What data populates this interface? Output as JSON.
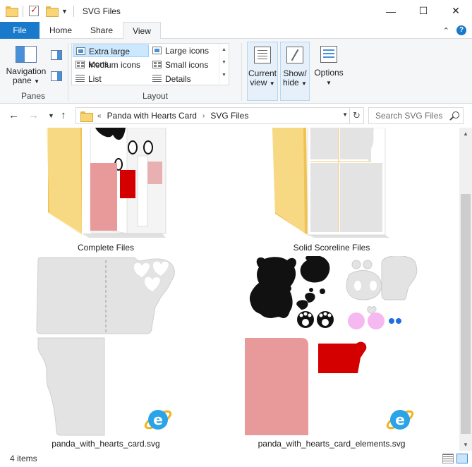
{
  "window": {
    "title": "SVG Files",
    "minimize": "—",
    "maximize": "☐",
    "close": "✕"
  },
  "ribbon": {
    "tabs": {
      "file": "File",
      "home": "Home",
      "share": "Share",
      "view": "View"
    },
    "collapse_glyph": "⌃",
    "help_glyph": "?",
    "panes": {
      "group_label": "Panes",
      "navigation_pane_line1": "Navigation",
      "navigation_pane_line2": "pane"
    },
    "layout": {
      "group_label": "Layout",
      "items": {
        "extra_large": "Extra large icons",
        "large": "Large icons",
        "medium": "Medium icons",
        "small": "Small icons",
        "list": "List",
        "details": "Details"
      },
      "selected": "Extra large icons"
    },
    "current_view": {
      "line1": "Current",
      "line2": "view"
    },
    "show_hide": {
      "line1": "Show/",
      "line2": "hide"
    },
    "options": {
      "label": "Options"
    }
  },
  "address": {
    "crumbs": [
      "Panda with Hearts Card",
      "SVG Files"
    ],
    "search_placeholder": "Search SVG Files"
  },
  "files": [
    {
      "name": "Complete Files",
      "type": "folder"
    },
    {
      "name": "Solid Scoreline Files",
      "type": "folder"
    },
    {
      "name": "panda_with_hearts_card.svg",
      "type": "svg"
    },
    {
      "name": "panda_with_hearts_card_elements.svg",
      "type": "svg"
    }
  ],
  "status": {
    "item_count": "4 items"
  },
  "colors": {
    "file_tab": "#1979ca",
    "folder_yellow": "#f8d675",
    "card_grey": "#e3e3e3",
    "panda_black": "#111111",
    "card_pink": "#e89a9a",
    "card_red": "#d40000",
    "paw_pink": "#f5b8f0",
    "dot_blue": "#1f6fe0"
  }
}
